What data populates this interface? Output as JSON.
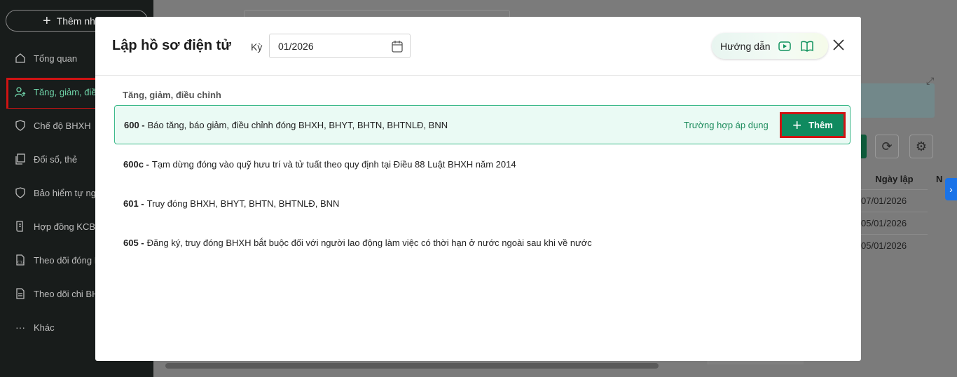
{
  "sidebar": {
    "add_button_label": "Thêm nha",
    "items": [
      {
        "label": "Tổng quan",
        "icon": "home-icon"
      },
      {
        "label": "Tăng, giảm, điề",
        "icon": "user-up-icon",
        "active": true
      },
      {
        "label": "Chế độ BHXH",
        "icon": "shield-heart-icon"
      },
      {
        "label": "Đổi sổ, thẻ",
        "icon": "copy-icon"
      },
      {
        "label": "Bảo hiểm tự ngu",
        "icon": "shield-icon"
      },
      {
        "label": "Hợp đồng KCB",
        "icon": "scroll-icon"
      },
      {
        "label": "Theo dõi đóng B",
        "icon": "doc-c12-icon"
      },
      {
        "label": "Theo dõi chi BH",
        "icon": "doc-list-icon"
      },
      {
        "label": "Khác",
        "icon": "more-icon"
      }
    ]
  },
  "background": {
    "table_header_date": "Ngày lập",
    "table_header_next": "N",
    "dates": [
      "07/01/2026",
      "05/01/2026",
      "05/01/2026"
    ]
  },
  "modal": {
    "title": "Lập hồ sơ điện tử",
    "period_label": "Kỳ",
    "period_value": "01/2026",
    "guide_label": "Hướng dẫn",
    "section_title": "Tăng, giảm, điều chỉnh",
    "apply_link": "Trường hợp áp dụng",
    "add_button": "Thêm",
    "forms": [
      {
        "code": "600 -",
        "text": "Báo tăng, báo giảm, điều chỉnh đóng BHXH, BHYT, BHTN, BHTNLĐ, BNN",
        "selected": true
      },
      {
        "code": "600c -",
        "text": "Tạm dừng đóng vào quỹ hưu trí và tử tuất theo quy định tại Điều 88 Luật BHXH năm 2014",
        "selected": false
      },
      {
        "code": "601 -",
        "text": "Truy đóng BHXH, BHYT, BHTN, BHTNLĐ, BNN",
        "selected": false
      },
      {
        "code": "605 -",
        "text": "Đăng ký, truy đóng BHXH bắt buộc đối với người lao động làm việc có thời hạn ở nước ngoài sau khi về nước",
        "selected": false
      }
    ]
  },
  "colors": {
    "accent": "#0f8a5f",
    "highlight_border": "#d01313",
    "selected_row_bg": "#eafaf4",
    "sidebar_bg": "#181c1b"
  }
}
